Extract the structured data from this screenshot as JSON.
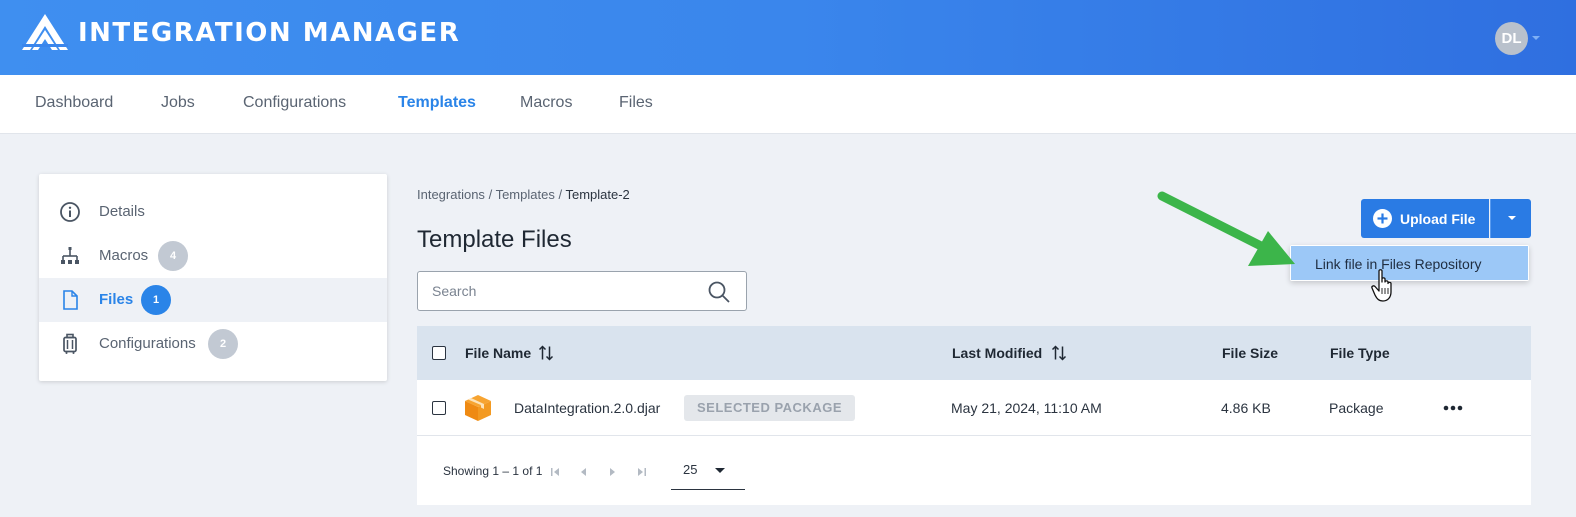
{
  "app": {
    "title": "INTEGRATION MANAGER",
    "user_initials": "DL"
  },
  "topnav": {
    "items": [
      {
        "label": "Dashboard",
        "active": false
      },
      {
        "label": "Jobs",
        "active": false
      },
      {
        "label": "Configurations",
        "active": false
      },
      {
        "label": "Templates",
        "active": true
      },
      {
        "label": "Macros",
        "active": false
      },
      {
        "label": "Files",
        "active": false
      }
    ]
  },
  "sidebar": {
    "items": [
      {
        "label": "Details",
        "icon": "info-icon",
        "count": null,
        "active": false
      },
      {
        "label": "Macros",
        "icon": "macros-icon",
        "count": "4",
        "active": false
      },
      {
        "label": "Files",
        "icon": "file-icon",
        "count": "1",
        "active": true
      },
      {
        "label": "Configurations",
        "icon": "luggage-icon",
        "count": "2",
        "active": false
      }
    ]
  },
  "breadcrumb": {
    "part1": "Integrations",
    "sep": "/",
    "part2": "Templates",
    "current": "Template-2"
  },
  "page": {
    "title": "Template Files"
  },
  "search": {
    "placeholder": "Search",
    "value": ""
  },
  "upload": {
    "label": "Upload File",
    "menu_item": "Link file in Files Repository"
  },
  "table": {
    "headers": {
      "name": "File Name",
      "modified": "Last Modified",
      "size": "File Size",
      "type": "File Type"
    },
    "rows": [
      {
        "name": "DataIntegration.2.0.djar",
        "badge": "SELECTED PACKAGE",
        "modified": "May 21, 2024, 11:10 AM",
        "size": "4.86 KB",
        "type": "Package"
      }
    ]
  },
  "pager": {
    "showing": "Showing 1 – 1 of 1",
    "page_size": "25"
  },
  "colors": {
    "accent": "#2a84e8",
    "header_start": "#3f8ff0",
    "header_end": "#2f6fe0",
    "menu_highlight": "#9cc8f7",
    "annotation_arrow": "#3cb54a"
  }
}
